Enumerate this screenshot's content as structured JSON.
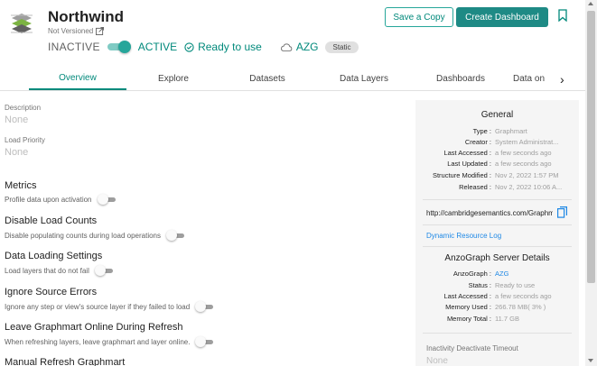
{
  "header": {
    "title": "Northwind",
    "versioned": "Not Versioned",
    "status_inactive": "INACTIVE",
    "status_active": "ACTIVE",
    "ready": "Ready to use",
    "server": "AZG",
    "badge": "Static",
    "save_copy": "Save a Copy",
    "create_dashboard": "Create Dashboard",
    "active_toggle_on": true
  },
  "tabs": [
    {
      "label": "Overview"
    },
    {
      "label": "Explore"
    },
    {
      "label": "Datasets"
    },
    {
      "label": "Data Layers"
    },
    {
      "label": "Dashboards"
    },
    {
      "label": "Data on"
    }
  ],
  "left": {
    "description_label": "Description",
    "description_value": "None",
    "priority_label": "Load Priority",
    "priority_value": "None",
    "settings": [
      {
        "title": "Metrics",
        "desc": "Profile data upon activation"
      },
      {
        "title": "Disable Load Counts",
        "desc": "Disable populating counts during load operations"
      },
      {
        "title": "Data Loading Settings",
        "desc": "Load layers that do not fail"
      },
      {
        "title": "Ignore Source Errors",
        "desc": "Ignore any step or view's source layer if they failed to load"
      },
      {
        "title": "Leave Graphmart Online During Refresh",
        "desc": "When refreshing layers, leave graphmart and layer online."
      },
      {
        "title": "Manual Refresh Graphmart",
        "desc": ""
      }
    ]
  },
  "panel": {
    "general_title": "General",
    "general": [
      {
        "key": "Type",
        "value": "Graphmart"
      },
      {
        "key": "Creator",
        "value": "System Administrat..."
      },
      {
        "key": "Last Accessed",
        "value": "a few seconds ago"
      },
      {
        "key": "Last Updated",
        "value": "a few seconds ago"
      },
      {
        "key": "Structure Modified",
        "value": "Nov 2, 2022 1:57 PM"
      },
      {
        "key": "Released",
        "value": "Nov 2, 2022 10:06 A..."
      }
    ],
    "url": "http://cambridgesemantics.com/Graphmart",
    "dynamic_link": "Dynamic Resource Log",
    "server_title": "AnzoGraph Server Details",
    "server": [
      {
        "key": "AnzoGraph",
        "value": "AZG"
      },
      {
        "key": "Status",
        "value": "Ready to use"
      },
      {
        "key": "Last Accessed",
        "value": "a few seconds ago"
      },
      {
        "key": "Memory Used",
        "value": "266.78 MB( 3% )"
      },
      {
        "key": "Memory Total",
        "value": "11.7 GB"
      }
    ],
    "inactivity_label": "Inactivity Deactivate Timeout",
    "inactivity_value": "None"
  },
  "colors": {
    "accent": "#00897b",
    "button": "#1e8a85",
    "link": "#1e88e5"
  },
  "icons": [
    "graphmart-logo-icon",
    "external-link-icon",
    "check-circle-icon",
    "cloud-icon",
    "bookmark-icon",
    "chevron-right-icon",
    "copy-icon"
  ]
}
